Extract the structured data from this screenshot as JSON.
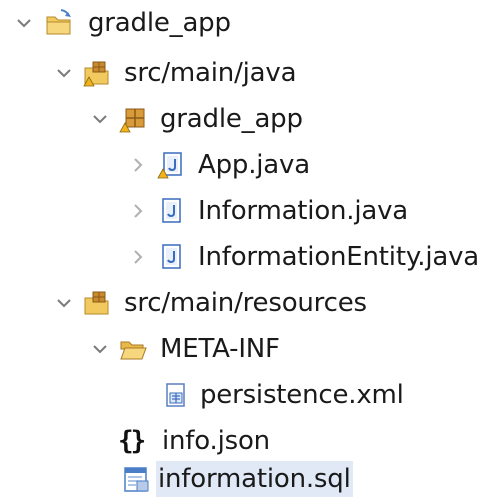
{
  "explorer": {
    "items": [
      {
        "label": "gradle_app",
        "icon": "project-folder-icon",
        "expanded": true
      },
      {
        "label": "src/main/java",
        "icon": "source-folder-icon",
        "expanded": true
      },
      {
        "label": "gradle_app",
        "icon": "package-icon",
        "expanded": true
      },
      {
        "label": "App.java",
        "icon": "java-file-icon",
        "expanded": false
      },
      {
        "label": "Information.java",
        "icon": "java-file-icon",
        "expanded": false
      },
      {
        "label": "InformationEntity.java",
        "icon": "java-file-icon",
        "expanded": false
      },
      {
        "label": "src/main/resources",
        "icon": "source-folder-icon",
        "expanded": true
      },
      {
        "label": "META-INF",
        "icon": "folder-open-icon",
        "expanded": true
      },
      {
        "label": "persistence.xml",
        "icon": "xml-file-icon"
      },
      {
        "label": "info.json",
        "icon": "json-file-icon"
      },
      {
        "label": "information.sql",
        "icon": "sql-file-icon",
        "selected": true
      }
    ]
  },
  "colors": {
    "chevron": "#7a7a7a",
    "folder": "#e8b84a",
    "package": "#c88a2c",
    "java_file": "#3a6bbf",
    "warning": "#f2b21a",
    "selection": "#e1e9f6"
  }
}
